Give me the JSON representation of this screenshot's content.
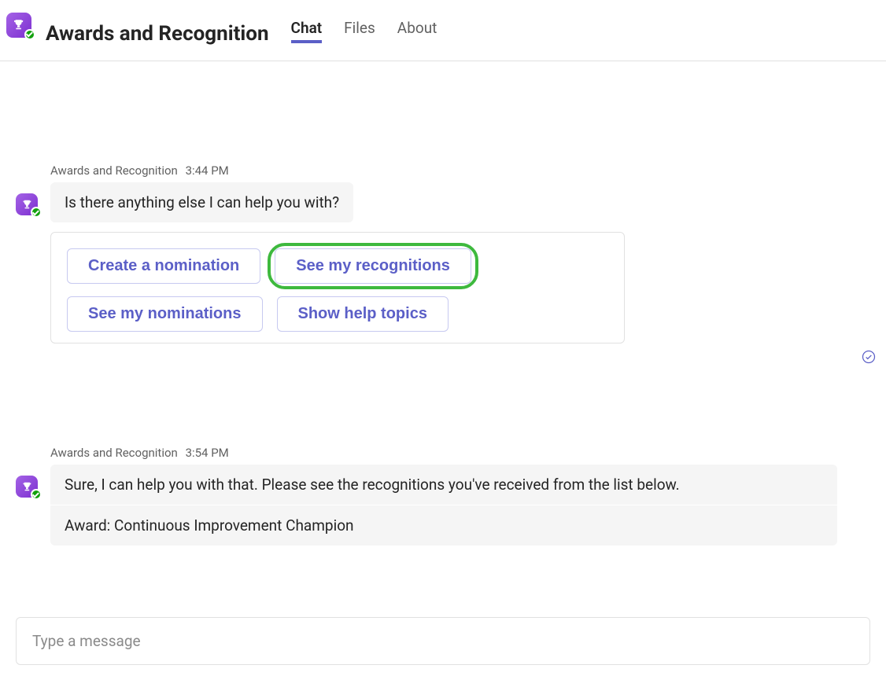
{
  "header": {
    "app_title": "Awards and Recognition",
    "tabs": [
      {
        "label": "Chat",
        "active": true
      },
      {
        "label": "Files",
        "active": false
      },
      {
        "label": "About",
        "active": false
      }
    ]
  },
  "messages": [
    {
      "sender": "Awards and Recognition",
      "time": "3:44 PM",
      "text": "Is there anything else I can help you with?",
      "card_actions": {
        "row1": [
          {
            "label": "Create a nomination",
            "highlight": false
          },
          {
            "label": "See my recognitions",
            "highlight": true
          }
        ],
        "row2": [
          {
            "label": "See my nominations",
            "highlight": false
          },
          {
            "label": "Show help topics",
            "highlight": false
          }
        ]
      }
    },
    {
      "sender": "Awards and Recognition",
      "time": "3:54 PM",
      "text_line1": "Sure, I can help you with that. Please see the recognitions you've received from the list below.",
      "text_line2": "Award: Continuous Improvement Champion"
    }
  ],
  "compose": {
    "placeholder": "Type a message"
  }
}
